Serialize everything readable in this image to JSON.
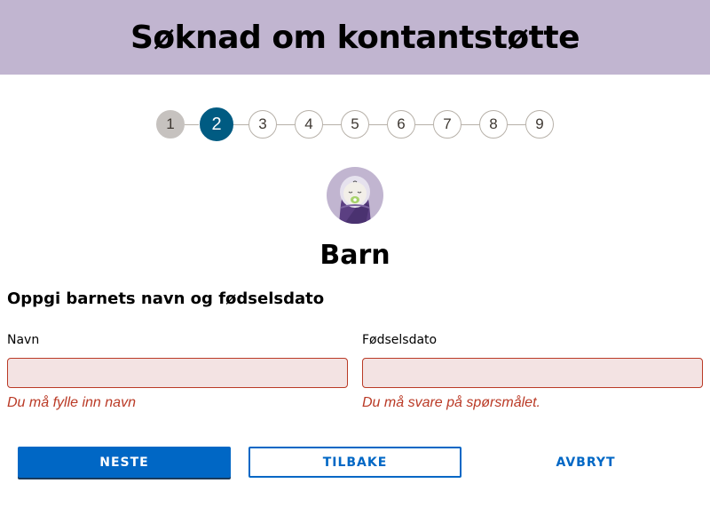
{
  "header": {
    "title": "Søknad om kontantstøtte"
  },
  "stepper": {
    "steps": [
      "1",
      "2",
      "3",
      "4",
      "5",
      "6",
      "7",
      "8",
      "9"
    ],
    "completed": [
      "1"
    ],
    "active": "2"
  },
  "section": {
    "title": "Barn",
    "icon": "baby-avatar-icon"
  },
  "form": {
    "question": "Oppgi barnets navn og fødselsdato",
    "name": {
      "label": "Navn",
      "value": "",
      "error": "Du må fylle inn navn"
    },
    "birthdate": {
      "label": "Fødselsdato",
      "value": "",
      "error": "Du må svare på spørsmålet."
    }
  },
  "buttons": {
    "next": "NESTE",
    "back": "TILBAKE",
    "cancel": "AVBRYT"
  },
  "colors": {
    "header_bg": "#c1b5d0",
    "active_step": "#005b82",
    "completed_step": "#c6c2bf",
    "error": "#ba3a26",
    "input_error_bg": "#f3e3e3",
    "primary": "#0067c5"
  }
}
